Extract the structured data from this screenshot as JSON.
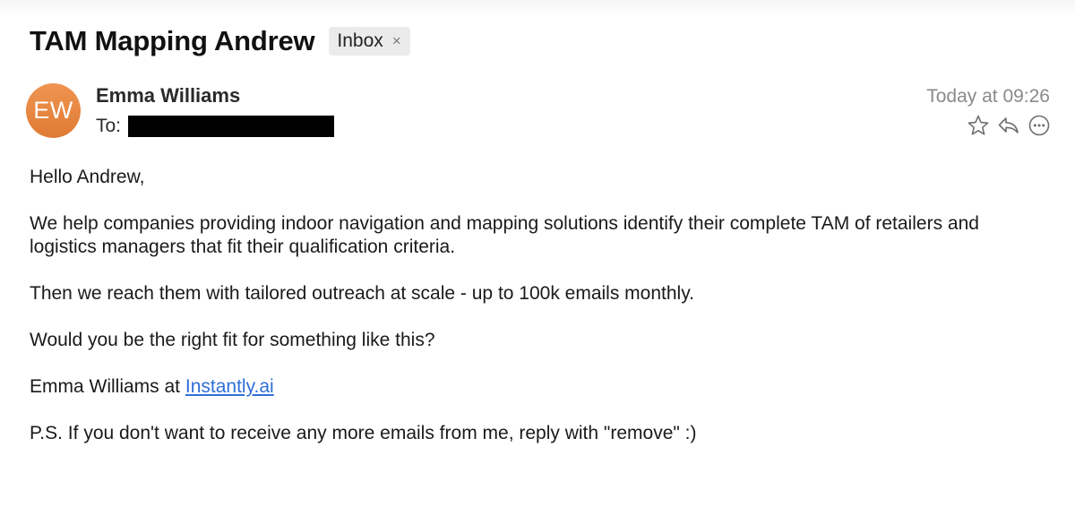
{
  "email": {
    "subject": "TAM Mapping Andrew",
    "mailbox_tag": "Inbox",
    "mailbox_tag_close": "×",
    "sender": {
      "initials": "EW",
      "name": "Emma Williams",
      "avatar_color": "#e8843f"
    },
    "to_label": "To:",
    "date": "Today at 09:26",
    "actions": [
      "star-icon",
      "reply-icon",
      "more-icon"
    ],
    "body": {
      "greeting": "Hello Andrew,",
      "paragraph1": "We help companies providing indoor navigation and mapping solutions identify their complete TAM of retailers and logistics managers that fit their qualification criteria.",
      "paragraph2": "Then we reach them with tailored outreach at scale - up to 100k emails monthly.",
      "paragraph3": "Would you be the right fit for something like this?",
      "signature_prefix": "Emma Williams at ",
      "signature_link": "Instantly.ai",
      "ps": "P.S. If you don't want to receive any more emails from me, reply with \"remove\" :)"
    }
  },
  "colors": {
    "link": "#2f6fd6",
    "date": "#8a8a8a"
  }
}
